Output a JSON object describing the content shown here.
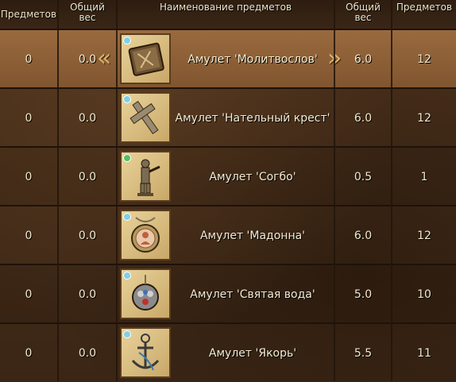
{
  "headers": {
    "count_left": "Предметов",
    "weight_left": "Общий\nвес",
    "name": "Наименование предметов",
    "weight_right": "Общий\nвес",
    "count_right": "Предметов"
  },
  "rows": [
    {
      "count_left": "0",
      "weight_left": "0.0",
      "name": "Амулет 'Молитвослов'",
      "weight_right": "6.0",
      "count_right": "12",
      "icon": "prayer-book-icon",
      "gem_color": "#7fd0e8",
      "selected": true
    },
    {
      "count_left": "0",
      "weight_left": "0.0",
      "name": "Амулет 'Нательный крест'",
      "weight_right": "6.0",
      "count_right": "12",
      "icon": "cross-icon",
      "gem_color": "#7fd0e8",
      "selected": false
    },
    {
      "count_left": "0",
      "weight_left": "0.0",
      "name": "Амулет 'Согбо'",
      "weight_right": "0.5",
      "count_right": "1",
      "icon": "figurine-icon",
      "gem_color": "#52c060",
      "selected": false
    },
    {
      "count_left": "0",
      "weight_left": "0.0",
      "name": "Амулет 'Мадонна'",
      "weight_right": "6.0",
      "count_right": "12",
      "icon": "madonna-locket-icon",
      "gem_color": "#7fd0e8",
      "selected": false
    },
    {
      "count_left": "0",
      "weight_left": "0.0",
      "name": "Амулет 'Святая вода'",
      "weight_right": "5.0",
      "count_right": "10",
      "icon": "holy-water-icon",
      "gem_color": "#7fd0e8",
      "selected": false
    },
    {
      "count_left": "0",
      "weight_left": "0.0",
      "name": "Амулет 'Якорь'",
      "weight_right": "5.5",
      "count_right": "11",
      "icon": "anchor-icon",
      "gem_color": "#7fd0e8",
      "selected": false
    }
  ]
}
